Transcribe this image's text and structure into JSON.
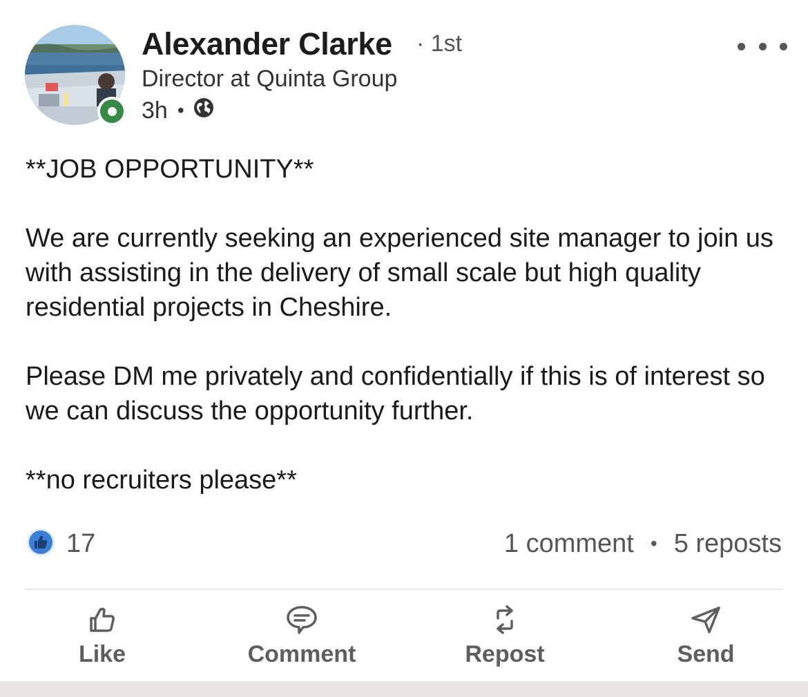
{
  "post": {
    "author": {
      "name": "Alexander Clarke",
      "degree": "· 1st",
      "headline": "Director at Quinta Group",
      "time": "3h",
      "visibility_icon": "globe-icon",
      "online": true
    },
    "body": {
      "heading": "**JOB OPPORTUNITY**",
      "paragraph1": "We are currently seeking an experienced site manager to join us with assisting in the delivery of small scale but high quality residential projects in Cheshire.",
      "paragraph2": "Please DM me privately and confidentially if this is of interest so we can discuss the opportunity further.",
      "footer": "**no recruiters please**"
    },
    "social": {
      "reaction_icon": "like-reaction-icon",
      "reaction_count": "17",
      "comments": "1 comment",
      "reposts": "5 reposts"
    },
    "actions": {
      "like": "Like",
      "comment": "Comment",
      "repost": "Repost",
      "send": "Send"
    }
  },
  "colors": {
    "presence_green": "#378a45",
    "like_blue": "#3b7ed6",
    "action_gray": "#5e5e5e",
    "text_secondary": "#555555"
  }
}
